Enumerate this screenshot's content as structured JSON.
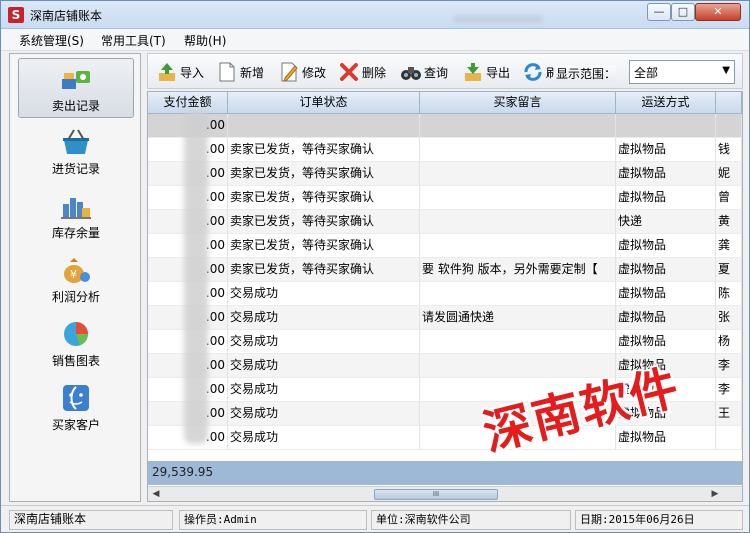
{
  "window": {
    "title": "深南店铺账本",
    "app_icon_letter": "S"
  },
  "menu": [
    "系统管理(S)",
    "常用工具(T)",
    "帮助(H)"
  ],
  "sidebar": {
    "items": [
      {
        "label": "卖出记录",
        "icon": "sales-icon",
        "active": true
      },
      {
        "label": "进货记录",
        "icon": "basket-icon",
        "active": false
      },
      {
        "label": "库存余量",
        "icon": "inventory-icon",
        "active": false
      },
      {
        "label": "利润分析",
        "icon": "profit-icon",
        "active": false
      },
      {
        "label": "销售图表",
        "icon": "pie-chart-icon",
        "active": false
      },
      {
        "label": "买家客户",
        "icon": "customer-icon",
        "active": false
      }
    ]
  },
  "toolbar": {
    "import": "导入",
    "add": "新增",
    "edit": "修改",
    "delete": "删除",
    "query": "查询",
    "export": "导出",
    "refresh": "刷",
    "range_label": "显示范围：",
    "range_value": "全部"
  },
  "grid": {
    "columns": [
      "支付金额",
      "订单状态",
      "买家留言",
      "运送方式",
      ""
    ],
    "rows": [
      {
        "amount": ".00",
        "status": "",
        "message": "",
        "shipping": "",
        "extra": ""
      },
      {
        "amount": ".00",
        "status": "卖家已发货，等待买家确认",
        "message": "",
        "shipping": "虚拟物品",
        "extra": "钱"
      },
      {
        "amount": ".00",
        "status": "卖家已发货，等待买家确认",
        "message": "",
        "shipping": "虚拟物品",
        "extra": "妮"
      },
      {
        "amount": ".00",
        "status": "卖家已发货，等待买家确认",
        "message": "",
        "shipping": "虚拟物品",
        "extra": "曾"
      },
      {
        "amount": ".00",
        "status": "卖家已发货，等待买家确认",
        "message": "",
        "shipping": "快递",
        "extra": "黄"
      },
      {
        "amount": ".00",
        "status": "卖家已发货，等待买家确认",
        "message": "",
        "shipping": "虚拟物品",
        "extra": "龚"
      },
      {
        "amount": ".00",
        "status": "卖家已发货，等待买家确认",
        "message": "要 软件狗 版本，另外需要定制【",
        "shipping": "虚拟物品",
        "extra": "夏"
      },
      {
        "amount": ".00",
        "status": "交易成功",
        "message": "",
        "shipping": "虚拟物品",
        "extra": "陈"
      },
      {
        "amount": ".00",
        "status": "交易成功",
        "message": "请发圆通快递",
        "shipping": "虚拟物品",
        "extra": "张"
      },
      {
        "amount": ".00",
        "status": "交易成功",
        "message": "",
        "shipping": "虚拟物品",
        "extra": "杨"
      },
      {
        "amount": ".00",
        "status": "交易成功",
        "message": "",
        "shipping": "虚拟物品",
        "extra": "李"
      },
      {
        "amount": ".00",
        "status": "交易成功",
        "message": "",
        "shipping": "虚拟物品",
        "extra": "李"
      },
      {
        "amount": ".00",
        "status": "交易成功",
        "message": "",
        "shipping": "虚拟物品",
        "extra": "王"
      },
      {
        "amount": ".00",
        "status": "交易成功",
        "message": "",
        "shipping": "虚拟物品",
        "extra": ""
      }
    ],
    "total": "29,539.95",
    "scroll_thumb_grip": "III"
  },
  "status": {
    "app": "深南店铺账本",
    "operator": "操作员:Admin",
    "org": "单位:深南软件公司",
    "date": "日期:2015年06月26日"
  },
  "watermark": "深南软件",
  "colors": {
    "accent": "#9eb9d6",
    "watermark": "#e61b1b",
    "close": "#c7402a"
  }
}
